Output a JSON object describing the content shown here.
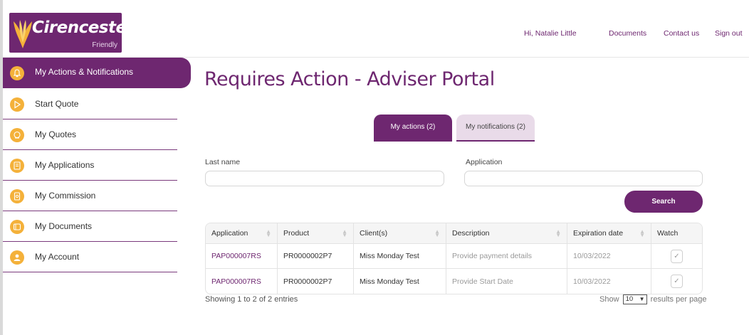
{
  "brand": {
    "name": "Cirencester",
    "subname": "Friendly"
  },
  "topnav": {
    "greeting": "Hi, Natalie Little",
    "documents": "Documents",
    "contact": "Contact us",
    "signout": "Sign out"
  },
  "sidebar": {
    "items": [
      {
        "label": "My Actions & Notifications",
        "icon": "bell-icon",
        "active": true
      },
      {
        "label": "Start Quote",
        "icon": "play-icon",
        "active": false
      },
      {
        "label": "My Quotes",
        "icon": "quote-icon",
        "active": false
      },
      {
        "label": "My Applications",
        "icon": "application-icon",
        "active": false
      },
      {
        "label": "My Commission",
        "icon": "commission-icon",
        "active": false
      },
      {
        "label": "My Documents",
        "icon": "document-icon",
        "active": false
      },
      {
        "label": "My Account",
        "icon": "user-icon",
        "active": false
      }
    ]
  },
  "main": {
    "title": "Requires Action - Adviser Portal",
    "tabs": [
      {
        "label": "My actions (2)",
        "active": true
      },
      {
        "label": "My notifications (2)",
        "active": false
      }
    ],
    "filters": {
      "last_name_label": "Last name",
      "last_name_value": "",
      "application_label": "Application",
      "application_value": "",
      "search_label": "Search"
    },
    "table": {
      "headers": [
        "Application",
        "Product",
        "Client(s)",
        "Description",
        "Expiration date",
        "Watch"
      ],
      "rows": [
        {
          "application": "PAP000007RS",
          "product": "PR0000002P7",
          "client": "Miss Monday Test",
          "description": "Provide payment details",
          "expiration": "10/03/2022",
          "watch": "✓"
        },
        {
          "application": "PAP000007RS",
          "product": "PR0000002P7",
          "client": "Miss Monday Test",
          "description": "Provide Start Date",
          "expiration": "10/03/2022",
          "watch": "✓"
        }
      ]
    },
    "footer": {
      "showing": "Showing 1 to 2 of 2 entries",
      "show_label": "Show",
      "per_page_value": "10",
      "per_page_suffix": "results per page"
    }
  },
  "colors": {
    "brand_purple": "#6e2770",
    "icon_gold": "#f4b13a",
    "tab_inactive": "#e9dbe9"
  }
}
